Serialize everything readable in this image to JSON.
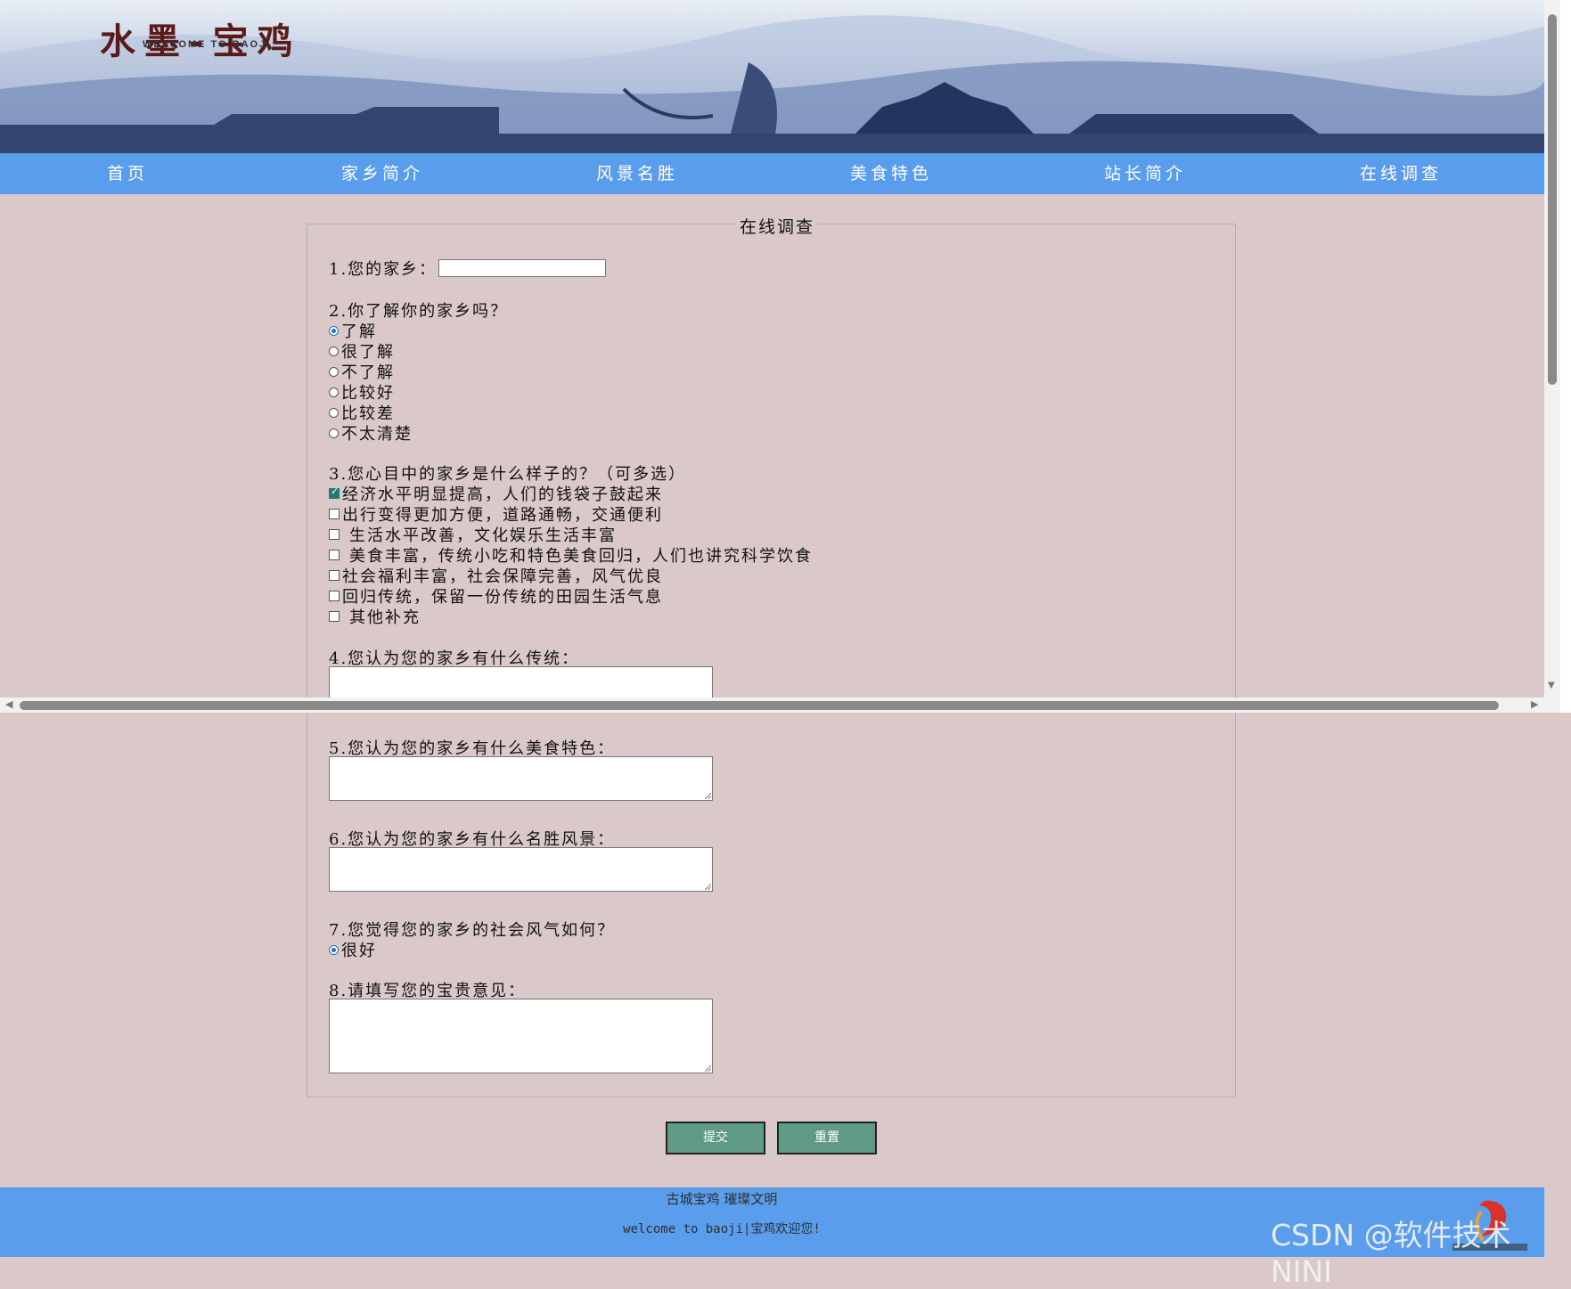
{
  "banner": {
    "title": "水墨-宝鸡",
    "subtitle": "WELCOME TO BAOJI"
  },
  "nav": {
    "items": [
      "首页",
      "家乡简介",
      "风景名胜",
      "美食特色",
      "站长简介",
      "在线调查"
    ]
  },
  "survey": {
    "legend": "在线调查",
    "q1": "1.您的家乡：",
    "q2": "2.你了解你的家乡吗？",
    "q2_options": [
      "了解",
      "很了解",
      "不了解",
      "比较好",
      "比较差",
      "不太清楚"
    ],
    "q2_selected": "了解",
    "q3": "3.您心目中的家乡是什么样子的？（可多选）",
    "q3_options": [
      "经济水平明显提高，人们的钱袋子鼓起来",
      "出行变得更加方便，道路通畅，交通便利",
      "生活水平改善，文化娱乐生活丰富",
      "美食丰富，传统小吃和特色美食回归，人们也讲究科学饮食",
      "社会福利丰富，社会保障完善，风气优良",
      "回归传统，保留一份传统的田园生活气息",
      "其他补充"
    ],
    "q3_checked": [
      "经济水平明显提高，人们的钱袋子鼓起来"
    ],
    "q4": "4.您认为您的家乡有什么传统：",
    "q5": "5.您认为您的家乡有什么美食特色：",
    "q6": "6.您认为您的家乡有什么名胜风景：",
    "q7": "7.您觉得您的家乡的社会风气如何？",
    "q7_options": [
      "很好"
    ],
    "q7_selected": "很好",
    "q8": "8.请填写您的宝贵意见："
  },
  "buttons": {
    "submit": "提交",
    "reset": "重置"
  },
  "footer": {
    "line1": "古城宝鸡  璀璨文明",
    "line2": "welcome to baoji|宝鸡欢迎您!"
  },
  "watermark": "CSDN @软件技术NINI",
  "colors": {
    "nav": "#5b9ded",
    "background": "#dbc9ca",
    "button": "#5f9a86"
  }
}
